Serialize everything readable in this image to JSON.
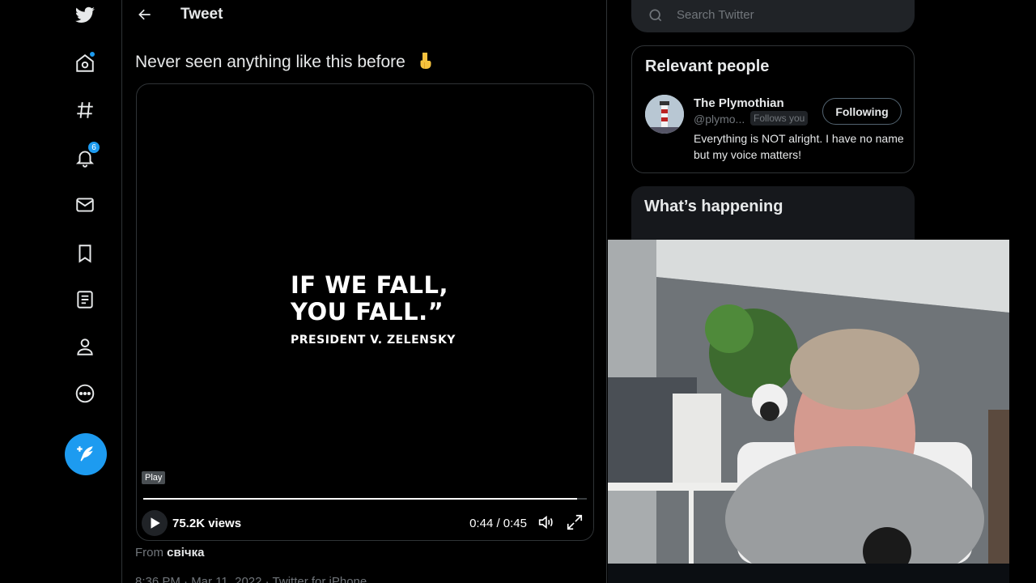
{
  "header": {
    "title": "Tweet"
  },
  "nav": {
    "notifications_count": "6"
  },
  "tweet": {
    "text": "Never seen anything like this before",
    "emoji": "pointing-down-hand",
    "video": {
      "quote_line1": "IF WE FALL,",
      "quote_line2": "YOU FALL.”",
      "attribution": "PRESIDENT V. ZELENSKY",
      "tooltip": "Play",
      "views": "75.2K views",
      "time": "0:44 / 0:45",
      "progress": 0.978
    },
    "from_label": "From",
    "from_name": "свічка",
    "meta": "8:36 PM · Mar 11, 2022 · Twitter for iPhone"
  },
  "search": {
    "placeholder": "Search Twitter"
  },
  "relevant": {
    "title": "Relevant people",
    "person": {
      "name": "The Plymothian",
      "handle": "@plymo...",
      "follows_you": "Follows you",
      "button": "Following",
      "bio": "Everything is NOT alright. I have no name but my voice matters!"
    }
  },
  "happening": {
    "title": "What’s happening"
  },
  "colors": {
    "accent": "#1d9bf0",
    "background": "#000000",
    "border": "#2f3336",
    "muted": "#71767b"
  }
}
